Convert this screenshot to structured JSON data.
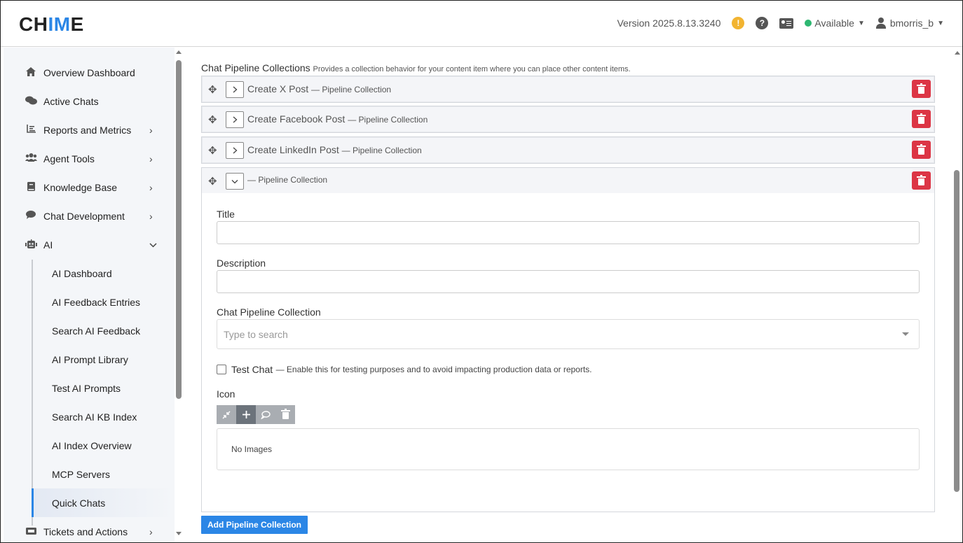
{
  "header": {
    "logo_prefix": "CH",
    "logo_highlight": "IM",
    "logo_suffix": "E",
    "version": "Version 2025.8.13.3240",
    "warning_glyph": "!",
    "help_glyph": "?",
    "status": "Available",
    "status_color": "#2db771",
    "username": "bmorris_b"
  },
  "sidebar": {
    "items": [
      {
        "label": "Overview Dashboard",
        "icon": "home-icon",
        "glyph": "⌂",
        "has_chevron": false
      },
      {
        "label": "Active Chats",
        "icon": "comments-icon",
        "glyph": "💬",
        "has_chevron": false
      },
      {
        "label": "Reports and Metrics",
        "icon": "chart-icon",
        "glyph": "☰",
        "chevron": "›"
      },
      {
        "label": "Agent Tools",
        "icon": "users-icon",
        "glyph": "👥",
        "chevron": "›"
      },
      {
        "label": "Knowledge Base",
        "icon": "book-icon",
        "glyph": "▤",
        "chevron": "›"
      },
      {
        "label": "Chat Development",
        "icon": "chat-bubble-icon",
        "glyph": "●",
        "chevron": "›"
      },
      {
        "label": "AI",
        "icon": "robot-icon",
        "glyph": "🤖",
        "chevron": "⌄"
      },
      {
        "label": "Tickets and Actions",
        "icon": "ticket-icon",
        "glyph": "▬",
        "chevron": "›"
      }
    ],
    "ai_subitems": [
      "AI Dashboard",
      "AI Feedback Entries",
      "Search AI Feedback",
      "AI Prompt Library",
      "Test AI Prompts",
      "Search AI KB Index",
      "AI Index Overview",
      "MCP Servers",
      "Quick Chats"
    ],
    "active_subitem": "Quick Chats"
  },
  "main": {
    "section_title": "Chat Pipeline Collections",
    "section_desc": "Provides a collection behavior for your content item where you can place other content items.",
    "collections": [
      {
        "name": "Create X Post",
        "suffix": "— Pipeline Collection"
      },
      {
        "name": "Create Facebook Post",
        "suffix": "— Pipeline Collection"
      },
      {
        "name": "Create LinkedIn Post",
        "suffix": "— Pipeline Collection"
      }
    ],
    "expanded": {
      "suffix": "— Pipeline Collection",
      "title_label": "Title",
      "title_value": "",
      "description_label": "Description",
      "description_value": "",
      "pipeline_label": "Chat Pipeline Collection",
      "pipeline_placeholder": "Type to search",
      "test_chat_label": "Test Chat",
      "test_chat_desc": "— Enable this for testing purposes and to avoid impacting production data or reports.",
      "test_chat_checked": false,
      "icon_label": "Icon",
      "toolbar": [
        {
          "name": "collapse-icon",
          "glyph": "⤡"
        },
        {
          "name": "plus-icon",
          "glyph": "+"
        },
        {
          "name": "speech-bubble-icon",
          "glyph": "◯"
        },
        {
          "name": "trash-icon",
          "glyph": "🗑"
        }
      ],
      "no_images": "No Images"
    },
    "add_button": "Add Pipeline Collection"
  },
  "colors": {
    "accent": "#2b86e6",
    "danger": "#dc3545",
    "sidebar_bg": "#f4f6f9"
  }
}
